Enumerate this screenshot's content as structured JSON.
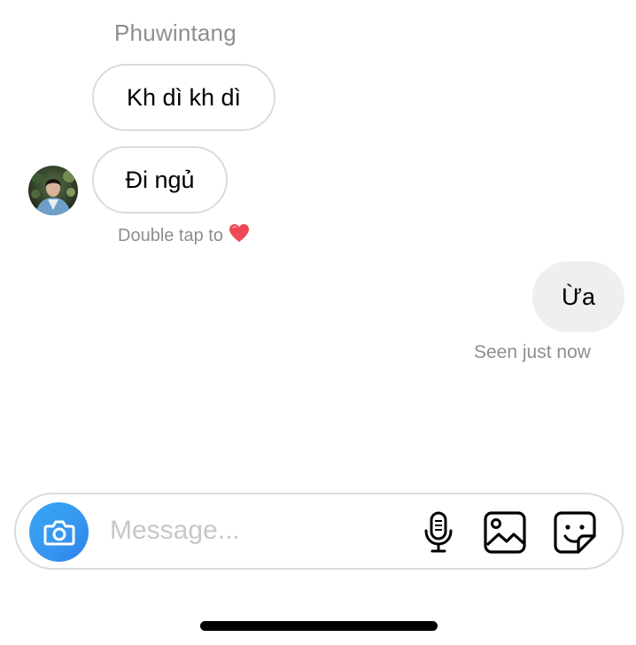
{
  "thread": {
    "sender_name": "Phuwintang",
    "incoming_messages": [
      "Kh dì kh dì",
      "Đi ngủ"
    ],
    "like_hint": "Double tap to",
    "outgoing_messages": [
      "Ừa"
    ],
    "seen_status": "Seen just now"
  },
  "composer": {
    "placeholder": "Message...",
    "icons": [
      "camera-icon",
      "microphone-icon",
      "gallery-icon",
      "sticker-icon"
    ],
    "camera_color": "#3797f0"
  },
  "colors": {
    "accent": "#3797f0",
    "heart": "#ed4956",
    "muted_text": "#8e8e8e",
    "bubble_border": "#dbdbdb",
    "outgoing_bubble": "#efefef"
  }
}
